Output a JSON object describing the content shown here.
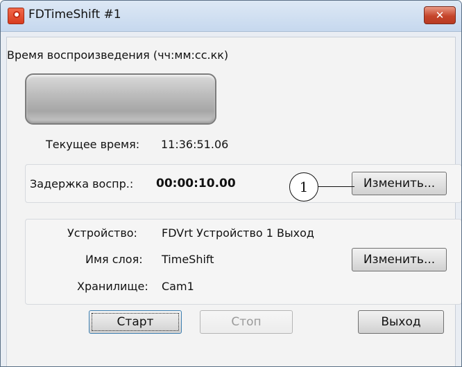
{
  "window": {
    "title": "FDTimeShift #1",
    "close_label": "✕"
  },
  "playback": {
    "label": "Время воспроизведения (чч:мм:сс.кк)",
    "current_time_label": "Текущее время:",
    "current_time_value": "11:36:51.06"
  },
  "delay": {
    "label": "Задержка воспр.:",
    "value": "00:00:10.00",
    "change_button": "Изменить...",
    "callout": "1"
  },
  "output": {
    "device_label": "Устройство:",
    "device_value": "FDVrt Устройство 1 Выход",
    "layer_label": "Имя слоя:",
    "layer_value": "TimeShift",
    "storage_label": "Хранилище:",
    "storage_value": "Cam1",
    "change_button": "Изменить..."
  },
  "buttons": {
    "start": "Старт",
    "stop": "Стоп",
    "exit": "Выход"
  }
}
